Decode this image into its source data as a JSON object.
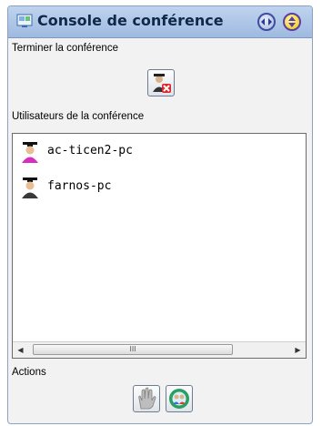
{
  "window": {
    "title": "Console de conférence"
  },
  "titlebar_buttons": {
    "swap": "swap-arrows-icon",
    "collapse": "collapse-arrows-icon"
  },
  "sections": {
    "end": {
      "label": "Terminer la conférence",
      "button_icon": "end-conference-icon"
    },
    "users": {
      "label": "Utilisateurs de la conférence",
      "items": [
        {
          "name": "ac-ticen2-pc",
          "icon": "user-pink-icon"
        },
        {
          "name": "farnos-pc",
          "icon": "user-gray-icon"
        }
      ],
      "scroll_thumb_grip": "III"
    },
    "actions": {
      "label": "Actions",
      "buttons": [
        {
          "icon": "hand-icon"
        },
        {
          "icon": "share-screen-icon"
        }
      ]
    }
  },
  "colors": {
    "titlebar": "#bfd3ee",
    "border": "#8da2c0",
    "panel_bg": "#f2f2f2"
  }
}
